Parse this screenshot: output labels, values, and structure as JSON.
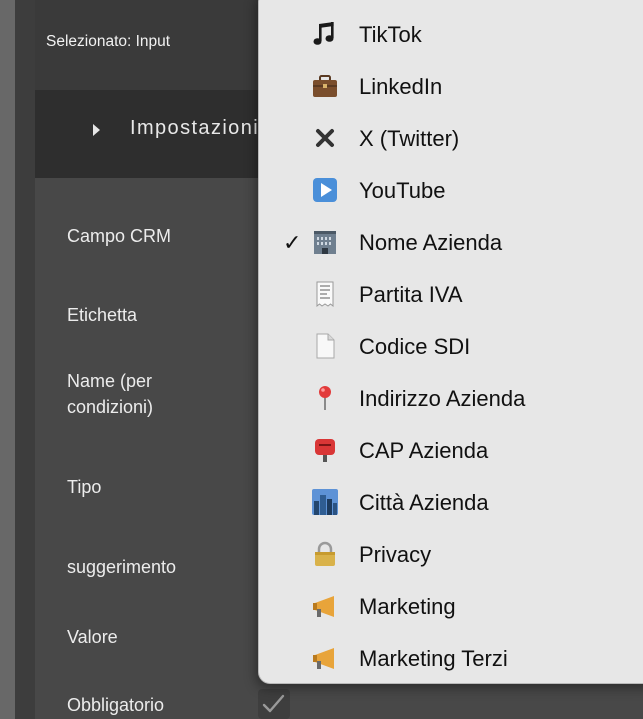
{
  "header": {
    "selected_label": "Selezionato: Input"
  },
  "settings": {
    "label": "Impostazioni"
  },
  "fields": [
    {
      "label": "Campo CRM"
    },
    {
      "label": "Etichetta"
    },
    {
      "label": "Name (per\ncondizioni)"
    },
    {
      "label": "Tipo"
    },
    {
      "label": "suggerimento"
    },
    {
      "label": "Valore"
    },
    {
      "label": "Obbligatorio"
    }
  ],
  "obbligatorio_checked": true,
  "dropdown": {
    "selected_index": 4,
    "check_mark": "✓",
    "items": [
      {
        "label": "TikTok",
        "icon": "music-note-icon"
      },
      {
        "label": "LinkedIn",
        "icon": "briefcase-icon"
      },
      {
        "label": "X (Twitter)",
        "icon": "x-mark-icon"
      },
      {
        "label": "YouTube",
        "icon": "play-button-icon"
      },
      {
        "label": "Nome Azienda",
        "icon": "office-building-icon"
      },
      {
        "label": "Partita IVA",
        "icon": "receipt-icon"
      },
      {
        "label": "Codice SDI",
        "icon": "document-icon"
      },
      {
        "label": "Indirizzo Azienda",
        "icon": "map-pin-icon"
      },
      {
        "label": "CAP Azienda",
        "icon": "postbox-icon"
      },
      {
        "label": "Città Azienda",
        "icon": "cityscape-icon"
      },
      {
        "label": "Privacy",
        "icon": "padlock-icon"
      },
      {
        "label": "Marketing",
        "icon": "megaphone-icon"
      },
      {
        "label": "Marketing Terzi",
        "icon": "megaphone-icon"
      }
    ]
  }
}
